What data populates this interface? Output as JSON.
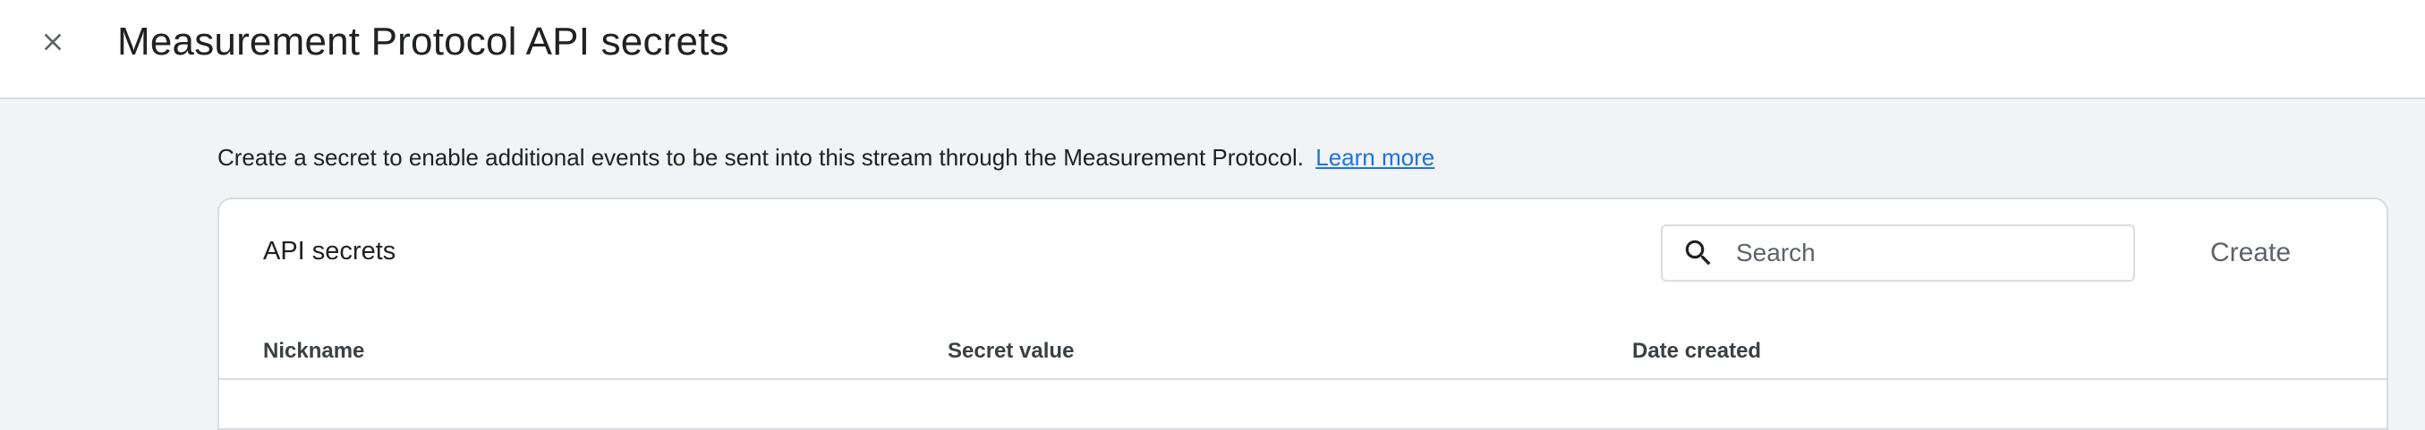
{
  "header": {
    "title": "Measurement Protocol API secrets",
    "close_icon": "close-icon"
  },
  "intro": {
    "text": "Create a secret to enable additional events to be sent into this stream through the Measurement Protocol.",
    "link_label": "Learn more"
  },
  "card": {
    "title": "API secrets",
    "search": {
      "placeholder": "Search",
      "value": "",
      "icon": "search-icon"
    },
    "create_label": "Create",
    "columns": [
      "Nickname",
      "Secret value",
      "Date created"
    ]
  },
  "colors": {
    "link": "#1a73e8",
    "background": "#f1f3f4",
    "border": "#dadce0"
  }
}
